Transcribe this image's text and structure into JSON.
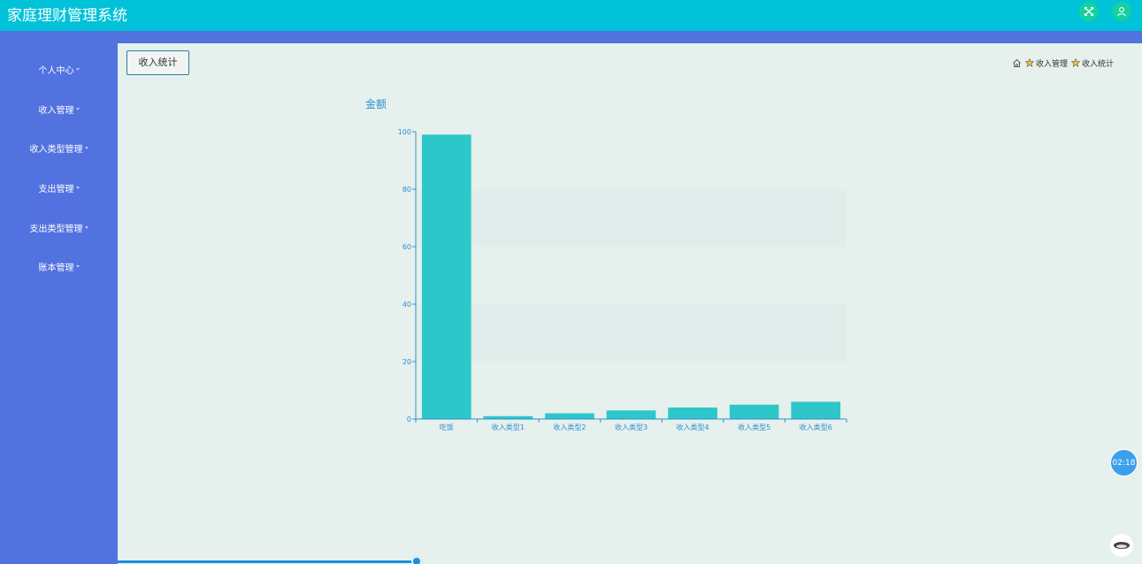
{
  "app": {
    "title": "家庭理财管理系统"
  },
  "header": {
    "fullscreen_icon": "fullscreen-icon",
    "user_icon": "user-icon",
    "button_color": "#14d1a0"
  },
  "colors": {
    "topbar": "#00c2d9",
    "sidebar": "#5272e0",
    "content_bg": "#e6f0ec",
    "bar": "#2ec7c9",
    "axis": "#2a8fd6"
  },
  "sidebar": {
    "items": [
      {
        "label": "个人中心"
      },
      {
        "label": "收入管理"
      },
      {
        "label": "收入类型管理"
      },
      {
        "label": "支出管理"
      },
      {
        "label": "支出类型管理"
      },
      {
        "label": "账本管理"
      }
    ]
  },
  "page": {
    "button_label": "收入统计"
  },
  "breadcrumb": {
    "home_icon": "home-icon",
    "star_icon": "star-icon",
    "items": [
      "收入管理",
      "收入统计"
    ]
  },
  "chart_data": {
    "type": "bar",
    "title": "",
    "ylabel": "金额",
    "xlabel": "",
    "categories": [
      "吃饭",
      "收入类型1",
      "收入类型2",
      "收入类型3",
      "收入类型4",
      "收入类型5",
      "收入类型6"
    ],
    "values": [
      99,
      1,
      2,
      3,
      4,
      5,
      6
    ],
    "ylim": [
      0,
      100
    ],
    "yticks": [
      0,
      20,
      40,
      60,
      80,
      100
    ],
    "grid": "alternating bands",
    "legend": "none"
  },
  "timer": {
    "text": "02:18"
  }
}
